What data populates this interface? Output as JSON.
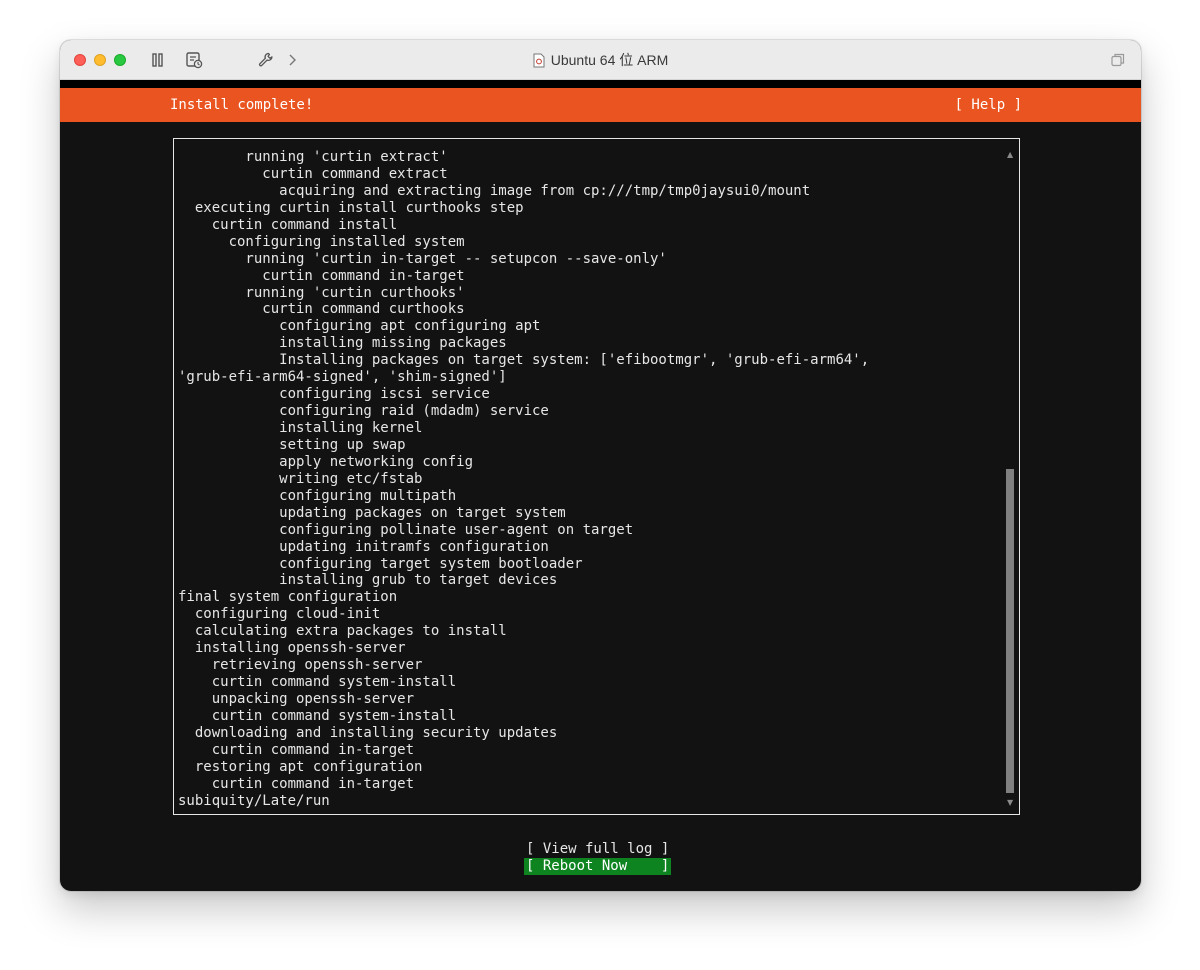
{
  "window": {
    "title": "Ubuntu 64 位 ARM",
    "controls": [
      "close-button",
      "minimize-button",
      "zoom-button"
    ],
    "toolbar_icons": [
      "pause-icon",
      "snapshot-icon",
      "wrench-icon",
      "chevron-right-icon",
      "restore-icon"
    ]
  },
  "header": {
    "title": "Install complete!",
    "help": "[ Help ]"
  },
  "log": {
    "lines": [
      "        running 'curtin extract'",
      "          curtin command extract",
      "            acquiring and extracting image from cp:///tmp/tmp0jaysui0/mount",
      "  executing curtin install curthooks step",
      "    curtin command install",
      "      configuring installed system",
      "        running 'curtin in-target -- setupcon --save-only'",
      "          curtin command in-target",
      "        running 'curtin curthooks'",
      "          curtin command curthooks",
      "            configuring apt configuring apt",
      "            installing missing packages",
      "            Installing packages on target system: ['efibootmgr', 'grub-efi-arm64',",
      "'grub-efi-arm64-signed', 'shim-signed']",
      "            configuring iscsi service",
      "            configuring raid (mdadm) service",
      "            installing kernel",
      "            setting up swap",
      "            apply networking config",
      "            writing etc/fstab",
      "            configuring multipath",
      "            updating packages on target system",
      "            configuring pollinate user-agent on target",
      "            updating initramfs configuration",
      "            configuring target system bootloader",
      "            installing grub to target devices",
      "final system configuration",
      "  configuring cloud-init",
      "  calculating extra packages to install",
      "  installing openssh-server",
      "    retrieving openssh-server",
      "    curtin command system-install",
      "    unpacking openssh-server",
      "    curtin command system-install",
      "  downloading and installing security updates",
      "    curtin command in-target",
      "  restoring apt configuration",
      "    curtin command in-target",
      "subiquity/Late/run"
    ],
    "scroll_up_glyph": "▲",
    "scroll_down_glyph": "▼"
  },
  "buttons": {
    "view_full_log": "[ View full log ]",
    "reboot_now": "[ Reboot Now    ]"
  },
  "colors": {
    "accent": "#e95420",
    "terminal_bg": "#121212",
    "terminal_fg": "#e6e6e6",
    "selected_button": "#0e8420"
  }
}
